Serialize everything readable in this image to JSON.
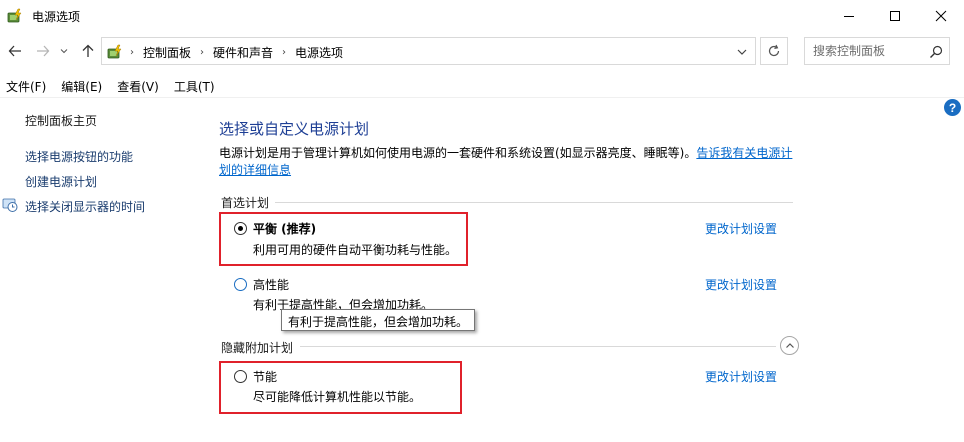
{
  "window": {
    "title": "电源选项",
    "icon": "power-options-icon",
    "controls": [
      "minimize-icon",
      "maximize-icon",
      "close-icon"
    ]
  },
  "nav": {
    "back_icon": "arrow-left-icon",
    "forward_icon": "arrow-right-icon",
    "recent_icon": "chevron-down-icon",
    "up_icon": "arrow-up-icon"
  },
  "address": {
    "breadcrumbs": [
      "控制面板",
      "硬件和声音",
      "电源选项"
    ],
    "separator": "›",
    "refresh_icon": "refresh-icon"
  },
  "search": {
    "placeholder": "搜索控制面板",
    "icon": "search-icon"
  },
  "menu": {
    "items": [
      "文件(F)",
      "编辑(E)",
      "查看(V)",
      "工具(T)"
    ]
  },
  "help": {
    "label": "?"
  },
  "sidebar": {
    "home": "控制面板主页",
    "links": [
      "选择电源按钮的功能",
      "创建电源计划",
      "选择关闭显示器的时间"
    ]
  },
  "main": {
    "heading": "选择或自定义电源计划",
    "description": "电源计划是用于管理计算机如何使用电源的一套硬件和系统设置(如显示器亮度、睡眠等)。",
    "description_link": "告诉我有关电源计划的详细信息",
    "preferred_label": "首选计划",
    "hidden_label": "隐藏附加计划",
    "change_label": "更改计划设置",
    "plans": [
      {
        "name": "平衡 (推荐)",
        "desc": "利用可用的硬件自动平衡功耗与性能。",
        "selected": true
      },
      {
        "name": "高性能",
        "desc": "有利于提高性能，但会增加功耗。",
        "selected": false
      },
      {
        "name": "节能",
        "desc": "尽可能降低计算机性能以节能。",
        "selected": false
      }
    ],
    "tooltip": "有利于提高性能，但会增加功耗。"
  },
  "colors": {
    "accent_link": "#0066cc",
    "heading": "#1e3f95",
    "highlight_box": "#e0212b",
    "help_badge": "#1a6dc2"
  }
}
